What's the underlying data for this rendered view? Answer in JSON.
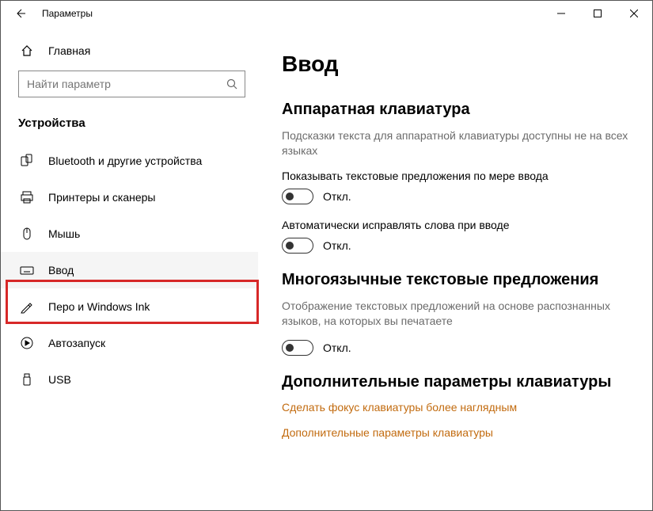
{
  "window": {
    "title": "Параметры"
  },
  "sidebar": {
    "home": "Главная",
    "search_placeholder": "Найти параметр",
    "category": "Устройства",
    "items": [
      {
        "label": "Bluetooth и другие устройства"
      },
      {
        "label": "Принтеры и сканеры"
      },
      {
        "label": "Мышь"
      },
      {
        "label": "Ввод"
      },
      {
        "label": "Перо и Windows Ink"
      },
      {
        "label": "Автозапуск"
      },
      {
        "label": "USB"
      }
    ]
  },
  "main": {
    "title": "Ввод",
    "section1": {
      "heading": "Аппаратная клавиатура",
      "desc": "Подсказки текста для аппаратной клавиатуры доступны не на всех языках",
      "opt1_label": "Показывать текстовые предложения по мере ввода",
      "opt2_label": "Автоматически исправлять слова при вводе"
    },
    "section2": {
      "heading": "Многоязычные текстовые предложения",
      "desc": "Отображение текстовых предложений на основе распознанных языков, на которых вы печатаете"
    },
    "section3": {
      "heading": "Дополнительные параметры клавиатуры",
      "link1": "Сделать фокус клавиатуры более наглядным",
      "link2": "Дополнительные параметры клавиатуры"
    },
    "off_label": "Откл."
  }
}
